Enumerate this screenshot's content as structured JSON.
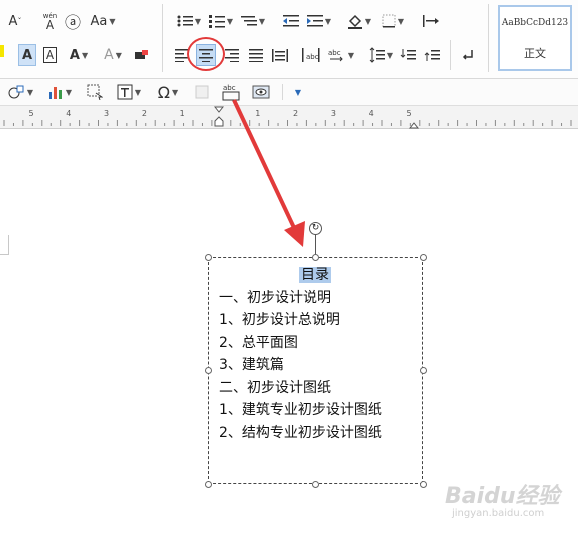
{
  "ribbon": {
    "font_row1": {
      "shrink_font": "A",
      "phonetic_guide": "wén",
      "enclosed_char": "ⓐ",
      "change_case": "Aa"
    },
    "font_row2": {
      "highlight": "A",
      "char_border": "A",
      "text_effect": "A"
    },
    "styles": {
      "preview_text": "AaBbCcDd123",
      "style_name": "正文"
    }
  },
  "toolbar2": {
    "omega_symbol": "Ω",
    "pinyin_label": "abc"
  },
  "ruler": {
    "numbers": [
      "5",
      "4",
      "3",
      "2",
      "1",
      "",
      "1",
      "2",
      "3",
      "4",
      "5"
    ]
  },
  "document": {
    "lines": [
      {
        "text": "目录",
        "selected": true
      },
      {
        "text": "一、初步设计说明",
        "selected": false
      },
      {
        "text": "1、初步设计总说明",
        "selected": false
      },
      {
        "text": "2、总平面图",
        "selected": false
      },
      {
        "text": "3、建筑篇",
        "selected": false
      },
      {
        "text": "二、初步设计图纸",
        "selected": false
      },
      {
        "text": "1、建筑专业初步设计图纸",
        "selected": false
      },
      {
        "text": "2、结构专业初步设计图纸",
        "selected": false
      }
    ]
  },
  "annotation": {
    "circle_color": "#e23a3a",
    "arrow_color": "#e23a3a",
    "highlight_color": "#aecbec"
  },
  "watermark": {
    "brand": "Baidu经验",
    "url": "jingyan.baidu.com"
  }
}
